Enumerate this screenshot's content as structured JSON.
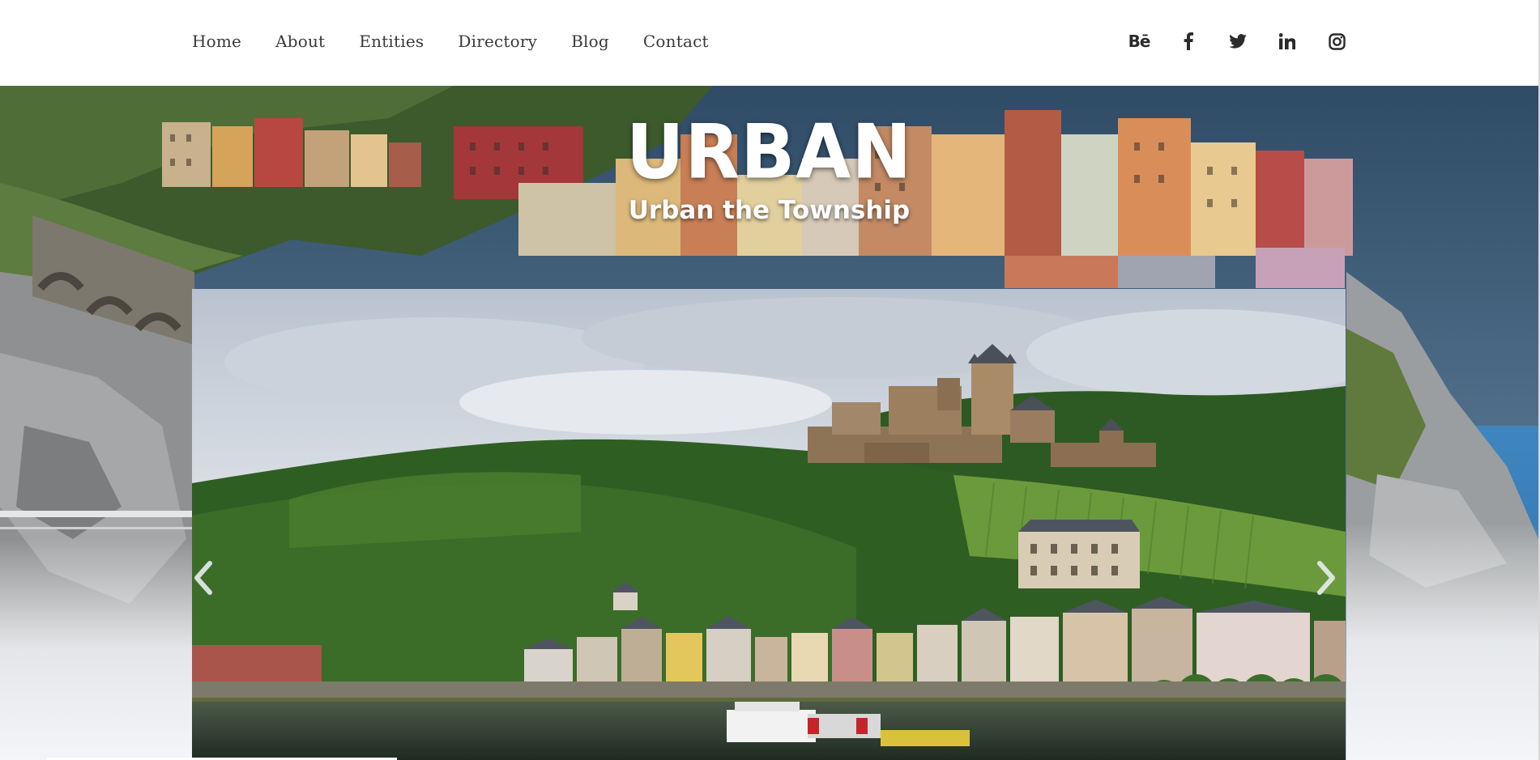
{
  "nav": {
    "items": [
      "Home",
      "About",
      "Entities",
      "Directory",
      "Blog",
      "Contact"
    ]
  },
  "social": {
    "behance_label": "Bē",
    "icons": [
      "behance-icon",
      "facebook-icon",
      "twitter-icon",
      "linkedin-icon",
      "instagram-icon"
    ]
  },
  "hero": {
    "title": "URBAN",
    "subtitle": "Urban the Township"
  },
  "carousel": {
    "prev_icon": "chevron-left-icon",
    "next_icon": "chevron-right-icon"
  },
  "colors": {
    "nav_text": "#3a3a3a",
    "icon": "#2b2b2b",
    "sky_dark": "#2e4a64",
    "hero_text": "#ffffff"
  }
}
